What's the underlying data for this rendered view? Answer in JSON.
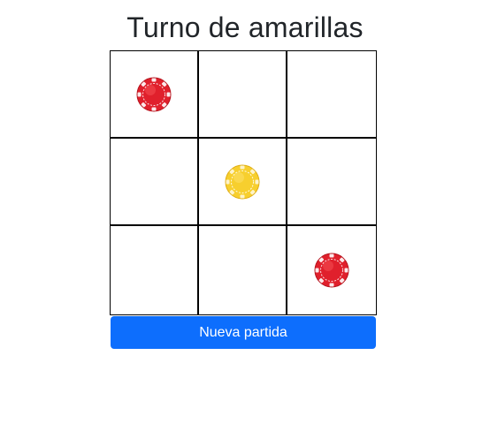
{
  "header": {
    "title": "Turno de amarillas"
  },
  "board": {
    "cells": [
      [
        "red",
        "",
        ""
      ],
      [
        "",
        "yellow",
        ""
      ],
      [
        "",
        "",
        "red"
      ]
    ]
  },
  "colors": {
    "red_chip": "#e0202c",
    "yellow_chip": "#f7cf2e",
    "button_bg": "#0d6efd"
  },
  "actions": {
    "new_game_label": "Nueva partida"
  }
}
